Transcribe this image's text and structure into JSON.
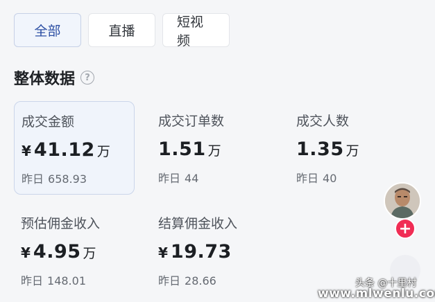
{
  "tabs": [
    {
      "label": "全部",
      "active": true
    },
    {
      "label": "直播",
      "active": false
    },
    {
      "label": "短视频",
      "active": false
    }
  ],
  "section": {
    "title": "整体数据",
    "help_icon": "?"
  },
  "metrics": [
    {
      "label": "成交金额",
      "currency": "¥",
      "value": "41.12",
      "unit": "万",
      "prev_label": "昨日",
      "prev_value": "658.93",
      "selected": true
    },
    {
      "label": "成交订单数",
      "currency": "",
      "value": "1.51",
      "unit": "万",
      "prev_label": "昨日",
      "prev_value": "44",
      "selected": false
    },
    {
      "label": "成交人数",
      "currency": "",
      "value": "1.35",
      "unit": "万",
      "prev_label": "昨日",
      "prev_value": "40",
      "selected": false
    },
    {
      "label": "预估佣金收入",
      "currency": "¥",
      "value": "4.95",
      "unit": "万",
      "prev_label": "昨日",
      "prev_value": "148.01",
      "selected": false
    },
    {
      "label": "结算佣金收入",
      "currency": "¥",
      "value": "19.73",
      "unit": "",
      "prev_label": "昨日",
      "prev_value": "28.66",
      "selected": false
    }
  ],
  "floating": {
    "follow_symbol": "+"
  },
  "watermark": {
    "line1": "头条 @十里村",
    "line2": "www.mlwenlu.com"
  },
  "colors": {
    "active_tab_text": "#2b4ea3",
    "follow_button": "#f02d55",
    "selected_card_bg": "#f0f4fb"
  }
}
